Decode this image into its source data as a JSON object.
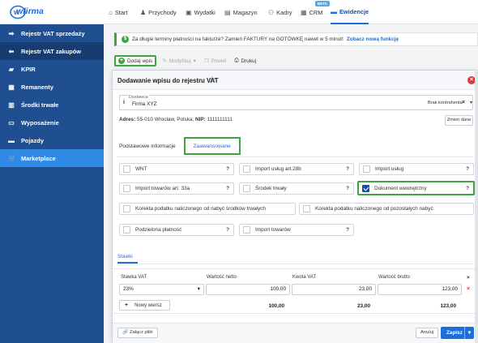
{
  "topbar": {
    "logo": "wfirma",
    "nav": [
      {
        "label": "Start",
        "icon": "home-icon"
      },
      {
        "label": "Przychody",
        "icon": "income-icon"
      },
      {
        "label": "Wydatki",
        "icon": "wallet-icon"
      },
      {
        "label": "Magazyn",
        "icon": "warehouse-icon"
      },
      {
        "label": "Kadry",
        "icon": "people-icon"
      },
      {
        "label": "CRM",
        "icon": "crm-icon",
        "badge": "BETA"
      },
      {
        "label": "Ewidencje",
        "icon": "records-icon",
        "active": true
      }
    ]
  },
  "sidebar": {
    "items": [
      {
        "label": "Rejestr VAT sprzedaży",
        "icon": "register-in-icon"
      },
      {
        "label": "Rejestr VAT zakupów",
        "icon": "register-out-icon",
        "active": true
      },
      {
        "label": "KPIR",
        "icon": "book-icon"
      },
      {
        "label": "Remanenty",
        "icon": "inventory-icon"
      },
      {
        "label": "Środki trwałe",
        "icon": "assets-icon"
      },
      {
        "label": "Wyposażenie",
        "icon": "laptop-icon"
      },
      {
        "label": "Pojazdy",
        "icon": "car-icon"
      },
      {
        "label": "Marketplace",
        "icon": "cart-icon"
      }
    ]
  },
  "banner": {
    "text": "Za długie terminy płatności na fakturze? Zamień FAKTURY na GOTÓWKĘ nawet w 5 minut!",
    "link": "Zobacz nową funkcję"
  },
  "toolbar": {
    "add": "Dodaj wpis",
    "modify": "Modyfikuj",
    "repeat": "Powiel",
    "print": "Drukuj"
  },
  "modal": {
    "title": "Dodawanie wpisu do rejestru VAT",
    "supplier": {
      "label": "Dostawca",
      "value": "Firma XYZ",
      "status": "Brak kontrahenta"
    },
    "address": {
      "prefix": "Adres:",
      "value": "55-010 Wrocław, Polska,",
      "nip_label": "NIP:",
      "nip": "1111111111"
    },
    "change_button": "Zmień dane",
    "tabs": [
      "Podstawowe informacje",
      "Zaawansowane"
    ],
    "options": [
      {
        "label": "WNT",
        "help": "?"
      },
      {
        "label": "Import usług art.28b",
        "help": "?"
      },
      {
        "label": "Import usług",
        "help": "?"
      },
      {
        "label": "Import towarów art. 33a",
        "help": "?"
      },
      {
        "label": "Środek trwały",
        "help": "?"
      },
      {
        "label": "Dokument wewnętrzny",
        "help": "?",
        "checked": true
      },
      {
        "label": "Korekta podatku naliczonego od nabyć środków trwałych"
      },
      {
        "label": "Korekta podatku naliczonego od pozostałych nabyć"
      },
      {
        "label": "Podzielona płatność",
        "help": "?"
      },
      {
        "label": "Import towarów",
        "help": "?"
      }
    ],
    "rates_tab": "Stawki",
    "table": {
      "headers": [
        "Stawka VAT",
        "Wartość netto",
        "Kwota VAT",
        "Wartość brutto"
      ],
      "row": {
        "rate": "23%",
        "net": "100,00",
        "vat": "23,00",
        "gross": "123,00"
      },
      "totals": {
        "net": "100,00",
        "vat": "23,00",
        "gross": "123,00"
      },
      "new_row": "Nowy wiersz",
      "delete_header": "×",
      "delete": "×"
    },
    "footer": {
      "attach": "Załącz pliki",
      "cancel": "Anuluj",
      "save": "Zapisz"
    }
  }
}
